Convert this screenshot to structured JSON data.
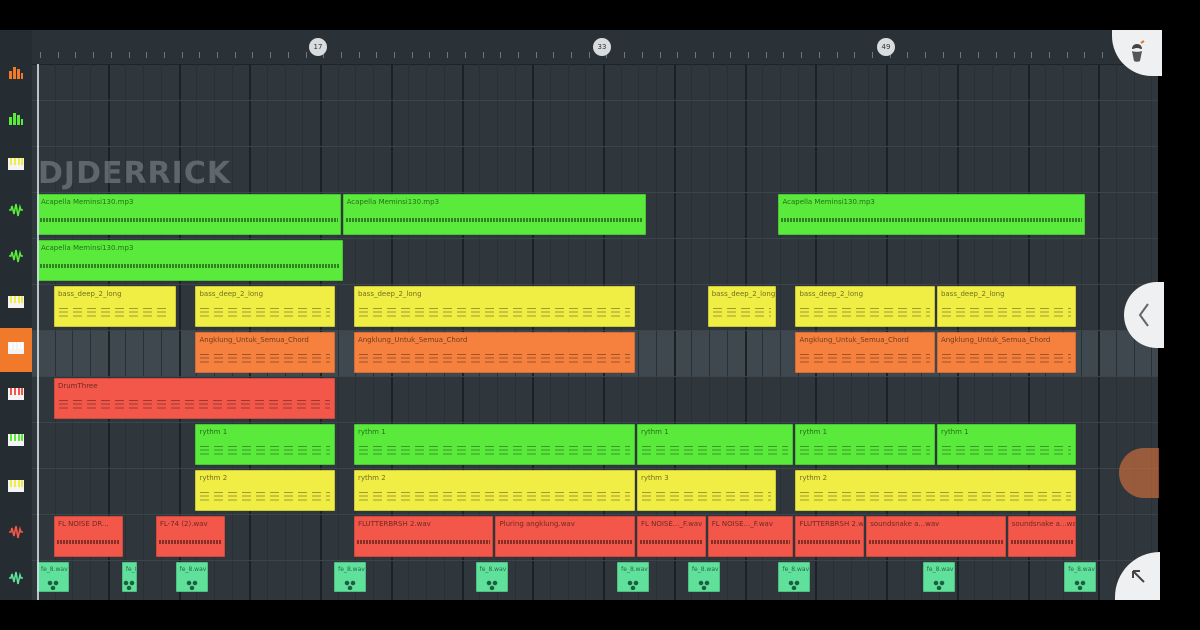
{
  "ruler": {
    "markers": [
      "17",
      "33",
      "49"
    ]
  },
  "watermark": "DJDERRICK",
  "colors": {
    "green": "#59ea3c",
    "yellow": "#f0ee45",
    "orange": "#f6813f",
    "red": "#f2574a",
    "teal": "#5fe09b",
    "active_track": "#f07a2a"
  },
  "tracks": [
    {
      "icon": "mixer-meter-icon",
      "color": "#f07a2a"
    },
    {
      "icon": "mixer-meter-icon",
      "color": "#59ea3c"
    },
    {
      "icon": "piano-keys-icon",
      "color": "#f0ee45"
    },
    {
      "icon": "audio-wave-icon",
      "color": "#59ea3c"
    },
    {
      "icon": "audio-wave-icon",
      "color": "#59ea3c"
    },
    {
      "icon": "piano-keys-icon",
      "color": "#f0ee45"
    },
    {
      "icon": "piano-keys-icon",
      "color": "#f6813f",
      "active": true
    },
    {
      "icon": "piano-keys-icon",
      "color": "#f2574a"
    },
    {
      "icon": "piano-keys-icon",
      "color": "#59ea3c"
    },
    {
      "icon": "piano-keys-icon",
      "color": "#f0ee45"
    },
    {
      "icon": "audio-wave-icon",
      "color": "#f2574a"
    },
    {
      "icon": "audio-wave-icon",
      "color": "#5fe09b"
    }
  ],
  "clips": [
    {
      "track": 3,
      "start": 0,
      "len": 10.8,
      "color": "green",
      "kind": "wave",
      "label": "Acapella Meminsi130.mp3"
    },
    {
      "track": 3,
      "start": 10.8,
      "len": 10.8,
      "color": "green",
      "kind": "wave",
      "label": "Acapella Meminsi130.mp3"
    },
    {
      "track": 3,
      "start": 26.2,
      "len": 10.9,
      "color": "green",
      "kind": "wave",
      "label": "Acapella Meminsi130.mp3"
    },
    {
      "track": 4,
      "start": 0,
      "len": 10.9,
      "color": "green",
      "kind": "wave",
      "label": "Acapella Meminsi130.mp3"
    },
    {
      "track": 5,
      "start": 0.6,
      "len": 4.4,
      "color": "yellow",
      "kind": "pattern",
      "label": "bass_deep_2_long"
    },
    {
      "track": 5,
      "start": 5.6,
      "len": 5,
      "color": "yellow",
      "kind": "pattern",
      "label": "bass_deep_2_long"
    },
    {
      "track": 5,
      "start": 11.2,
      "len": 10,
      "color": "yellow",
      "kind": "pattern",
      "label": "bass_deep_2_long"
    },
    {
      "track": 5,
      "start": 23.7,
      "len": 2.5,
      "color": "yellow",
      "kind": "pattern",
      "label": "bass_deep_2_long"
    },
    {
      "track": 5,
      "start": 26.8,
      "len": 5,
      "color": "yellow",
      "kind": "pattern",
      "label": "bass_deep_2_long"
    },
    {
      "track": 5,
      "start": 31.8,
      "len": 5,
      "color": "yellow",
      "kind": "pattern",
      "label": "bass_deep_2_long"
    },
    {
      "track": 6,
      "start": 5.6,
      "len": 5,
      "color": "orange",
      "kind": "pattern",
      "label": "Angklung_Untuk_Semua_Chord"
    },
    {
      "track": 6,
      "start": 11.2,
      "len": 10,
      "color": "orange",
      "kind": "pattern",
      "label": "Angklung_Untuk_Semua_Chord"
    },
    {
      "track": 6,
      "start": 26.8,
      "len": 5,
      "color": "orange",
      "kind": "pattern",
      "label": "Angklung_Untuk_Semua_Chord"
    },
    {
      "track": 6,
      "start": 31.8,
      "len": 5,
      "color": "orange",
      "kind": "pattern",
      "label": "Angklung_Untuk_Semua_Chord"
    },
    {
      "track": 7,
      "start": 0.6,
      "len": 10,
      "color": "red",
      "kind": "pattern",
      "label": "DrumThree"
    },
    {
      "track": 8,
      "start": 5.6,
      "len": 5,
      "color": "green",
      "kind": "pattern",
      "label": "rythm 1"
    },
    {
      "track": 8,
      "start": 11.2,
      "len": 10,
      "color": "green",
      "kind": "pattern",
      "label": "rythm 1"
    },
    {
      "track": 8,
      "start": 21.2,
      "len": 5.6,
      "color": "green",
      "kind": "pattern",
      "label": "rythm 1"
    },
    {
      "track": 8,
      "start": 26.8,
      "len": 5,
      "color": "green",
      "kind": "pattern",
      "label": "rythm 1"
    },
    {
      "track": 8,
      "start": 31.8,
      "len": 5,
      "color": "green",
      "kind": "pattern",
      "label": "rythm 1"
    },
    {
      "track": 9,
      "start": 5.6,
      "len": 5,
      "color": "yellow",
      "kind": "pattern",
      "label": "rythm 2"
    },
    {
      "track": 9,
      "start": 11.2,
      "len": 10,
      "color": "yellow",
      "kind": "pattern",
      "label": "rythm 2"
    },
    {
      "track": 9,
      "start": 21.2,
      "len": 5,
      "color": "yellow",
      "kind": "pattern",
      "label": "rythm 3"
    },
    {
      "track": 9,
      "start": 26.8,
      "len": 10,
      "color": "yellow",
      "kind": "pattern",
      "label": "rythm 2"
    },
    {
      "track": 10,
      "start": 0.6,
      "len": 2.5,
      "color": "red",
      "kind": "wave",
      "label": "FL NOISE DR..."
    },
    {
      "track": 10,
      "start": 4.2,
      "len": 2.5,
      "color": "red",
      "kind": "wave",
      "label": "FL-74 (2).wav"
    },
    {
      "track": 10,
      "start": 11.2,
      "len": 5,
      "color": "red",
      "kind": "wave",
      "label": "FLUTTERBRSH 2.wav"
    },
    {
      "track": 10,
      "start": 16.2,
      "len": 5,
      "color": "red",
      "kind": "wave",
      "label": "Pluring angklung.wav"
    },
    {
      "track": 10,
      "start": 21.2,
      "len": 2.5,
      "color": "red",
      "kind": "wave",
      "label": "FL NOISE..._F.wav"
    },
    {
      "track": 10,
      "start": 23.7,
      "len": 3.1,
      "color": "red",
      "kind": "wave",
      "label": "FL NOISE..._F.wav"
    },
    {
      "track": 10,
      "start": 26.8,
      "len": 2.5,
      "color": "red",
      "kind": "wave",
      "label": "FLUTTERBRSH 2.wav"
    },
    {
      "track": 10,
      "start": 29.3,
      "len": 5,
      "color": "red",
      "kind": "wave",
      "label": "soundsnake a...wav"
    },
    {
      "track": 10,
      "start": 34.3,
      "len": 2.5,
      "color": "red",
      "kind": "wave",
      "label": "soundsnake a...wav"
    },
    {
      "track": 11,
      "start": 0,
      "len": 1.2,
      "color": "teal",
      "kind": "beat",
      "label": "fe_8.wav"
    },
    {
      "track": 11,
      "start": 3,
      "len": 0.6,
      "color": "teal",
      "kind": "beat",
      "label": "fe_8.wav"
    },
    {
      "track": 11,
      "start": 4.9,
      "len": 1.2,
      "color": "teal",
      "kind": "beat",
      "label": "fe_8.wav"
    },
    {
      "track": 11,
      "start": 10.5,
      "len": 1.2,
      "color": "teal",
      "kind": "beat",
      "label": "fe_8.wav"
    },
    {
      "track": 11,
      "start": 15.5,
      "len": 1.2,
      "color": "teal",
      "kind": "beat",
      "label": "fe_8.wav"
    },
    {
      "track": 11,
      "start": 20.5,
      "len": 1.2,
      "color": "teal",
      "kind": "beat",
      "label": "fe_8.wav"
    },
    {
      "track": 11,
      "start": 23,
      "len": 1.2,
      "color": "teal",
      "kind": "beat",
      "label": "fe_8.wav"
    },
    {
      "track": 11,
      "start": 26.2,
      "len": 1.2,
      "color": "teal",
      "kind": "beat",
      "label": "fe_8.wav"
    },
    {
      "track": 11,
      "start": 31.3,
      "len": 1.2,
      "color": "teal",
      "kind": "beat",
      "label": "fe_8.wav"
    },
    {
      "track": 11,
      "start": 36.3,
      "len": 1.2,
      "color": "teal",
      "kind": "beat",
      "label": "fe_8.wav"
    }
  ]
}
